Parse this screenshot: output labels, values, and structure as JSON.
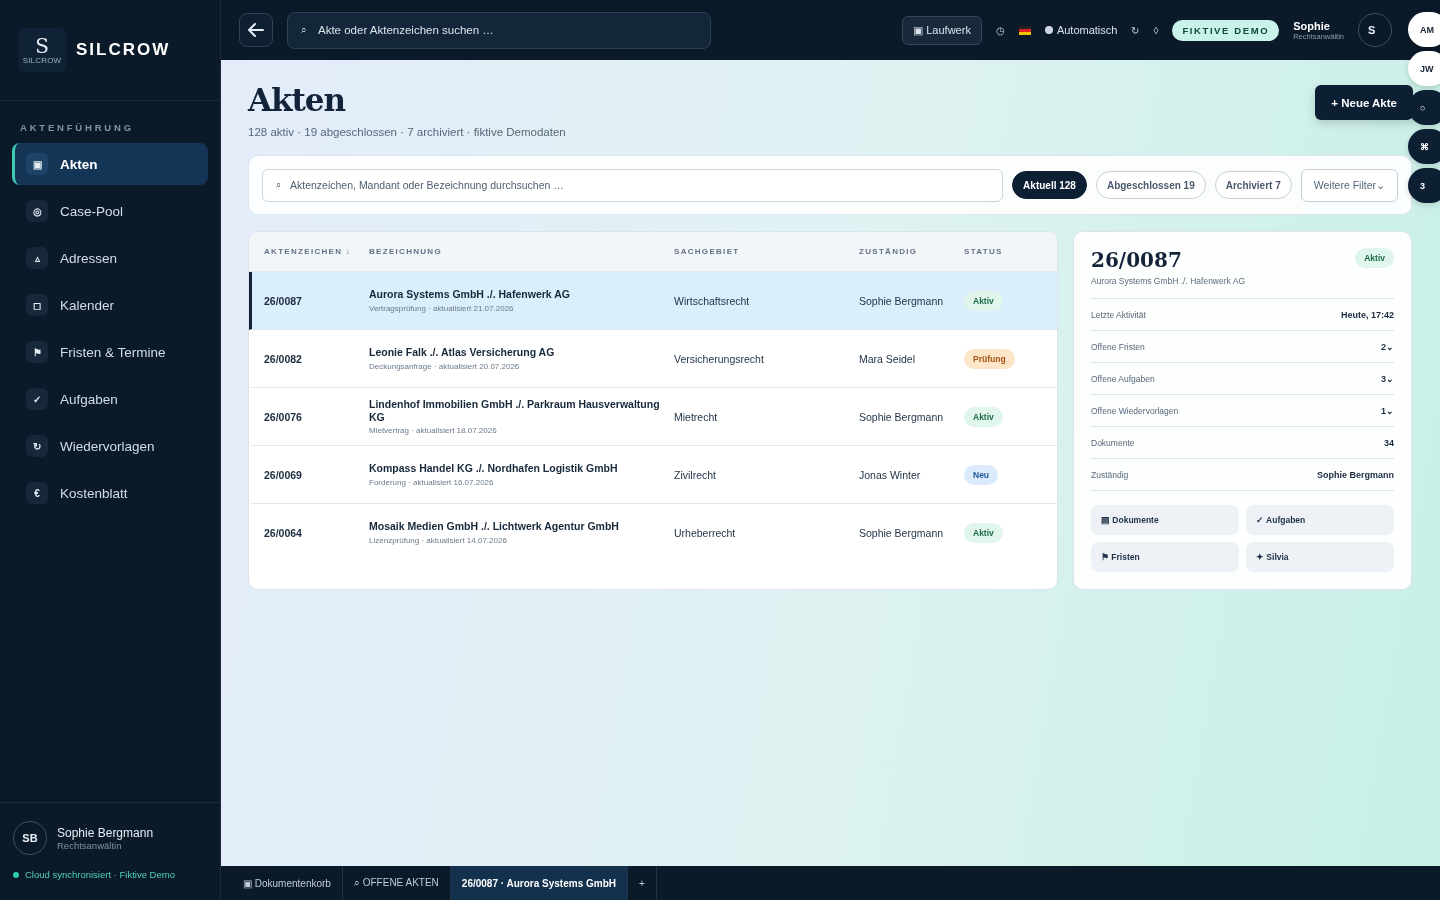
{
  "brand": {
    "logo_letter": "S",
    "logo_caption": "SILCROW",
    "name": "SILCROW"
  },
  "sidebar": {
    "section": "AKTENFÜHRUNG",
    "items": [
      {
        "icon": "▣",
        "label": "Akten",
        "selected": true
      },
      {
        "icon": "◎",
        "label": "Case-Pool",
        "selected": false
      },
      {
        "icon": "▵",
        "label": "Adressen",
        "selected": false
      },
      {
        "icon": "◻",
        "label": "Kalender",
        "selected": false
      },
      {
        "icon": "⚑",
        "label": "Fristen & Termine",
        "selected": false
      },
      {
        "icon": "✓",
        "label": "Aufgaben",
        "selected": false
      },
      {
        "icon": "↻",
        "label": "Wiedervorlagen",
        "selected": false
      },
      {
        "icon": "€",
        "label": "Kostenblatt",
        "selected": false
      }
    ],
    "user": {
      "initials": "SB",
      "name": "Sophie Bergmann",
      "role": "Rechtsanwältin"
    },
    "sync": "Cloud synchronisiert · Fiktive Demo"
  },
  "topbar": {
    "search": {
      "icon": "⌕",
      "placeholder": "Akte oder Aktenzeichen suchen …"
    },
    "drive_button": "▣ Laufwerk",
    "clock_icon": "◷",
    "theme": "Automatisch",
    "refresh_icon": "↻",
    "diamond_icon": "◊",
    "demo_badge": "FIKTIVE DEMO",
    "user": {
      "name": "Sophie",
      "role": "Rechtsanwältin",
      "initial": "S"
    }
  },
  "presence": [
    {
      "label": "AM",
      "kind": "light"
    },
    {
      "label": "JW",
      "kind": "light"
    },
    {
      "label": "○",
      "kind": "dark"
    },
    {
      "label": "⌘",
      "kind": "dark"
    },
    {
      "label": "3",
      "kind": "dark"
    }
  ],
  "page": {
    "title": "Akten",
    "subtitle": "128 aktiv · 19 abgeschlossen · 7 archiviert · fiktive Demodaten",
    "new_button": "+ Neue Akte"
  },
  "filter": {
    "search": {
      "icon": "⌕",
      "placeholder": "Aktenzeichen, Mandant oder Bezeichnung durchsuchen …"
    },
    "chips": [
      {
        "label": "Aktuell 128",
        "selected": true
      },
      {
        "label": "Abgeschlossen 19",
        "selected": false
      },
      {
        "label": "Archiviert 7",
        "selected": false
      }
    ],
    "more": "Weitere Filter⌄"
  },
  "table": {
    "columns": [
      "AKTENZEICHEN ↓",
      "BEZEICHNUNG",
      "SACHGEBIET",
      "ZUSTÄNDIG",
      "STATUS"
    ],
    "rows": [
      {
        "ref": "26/0087",
        "title": "Aurora Systems GmbH ./. Hafenwerk AG",
        "meta": "Vertragsprüfung · aktualisiert 21.07.2026",
        "area": "Wirtschaftsrecht",
        "owner": "Sophie Bergmann",
        "status": {
          "label": "Aktiv",
          "kind": "active"
        },
        "selected": true
      },
      {
        "ref": "26/0082",
        "title": "Leonie Falk ./. Atlas Versicherung AG",
        "meta": "Deckungsanfrage · aktualisiert 20.07.2026",
        "area": "Versicherungsrecht",
        "owner": "Mara Seidel",
        "status": {
          "label": "Prüfung",
          "kind": "review"
        },
        "selected": false
      },
      {
        "ref": "26/0076",
        "title": "Lindenhof Immobilien GmbH ./. Parkraum Hausverwaltung KG",
        "meta": "Mietvertrag · aktualisiert 18.07.2026",
        "area": "Mietrecht",
        "owner": "Sophie Bergmann",
        "status": {
          "label": "Aktiv",
          "kind": "active"
        },
        "selected": false
      },
      {
        "ref": "26/0069",
        "title": "Kompass Handel KG ./. Nordhafen Logistik GmbH",
        "meta": "Forderung · aktualisiert 16.07.2026",
        "area": "Zivilrecht",
        "owner": "Jonas Winter",
        "status": {
          "label": "Neu",
          "kind": "new"
        },
        "selected": false
      },
      {
        "ref": "26/0064",
        "title": "Mosaik Medien GmbH ./. Lichtwerk Agentur GmbH",
        "meta": "Lizenzprüfung · aktualisiert 14.07.2026",
        "area": "Urheberrecht",
        "owner": "Sophie Bergmann",
        "status": {
          "label": "Aktiv",
          "kind": "active"
        },
        "selected": false
      }
    ]
  },
  "detail": {
    "ref": "26/0087",
    "parties": "Aurora Systems GmbH ./. Hafenwerk AG",
    "status": {
      "label": "Aktiv",
      "kind": "active"
    },
    "facts": [
      {
        "label": "Letzte Aktivität",
        "value": "Heute, 17:42"
      },
      {
        "label": "Offene Fristen",
        "value": "2⌄"
      },
      {
        "label": "Offene Aufgaben",
        "value": "3⌄"
      },
      {
        "label": "Offene Wiedervorlagen",
        "value": "1⌄"
      },
      {
        "label": "Dokumente",
        "value": "34"
      },
      {
        "label": "Zuständig",
        "value": "Sophie Bergmann"
      }
    ],
    "actions": [
      "▤ Dokumente",
      "✓ Aufgaben",
      "⚑ Fristen",
      "✦ Silvia"
    ]
  },
  "bottom_tabs": [
    {
      "label": "▣ Dokumentenkorb",
      "selected": false
    },
    {
      "label": "⌕ OFFENE AKTEN",
      "selected": false
    },
    {
      "label": "26/0087 · Aurora Systems GmbH",
      "selected": true
    },
    {
      "label": "+",
      "selected": false
    }
  ]
}
